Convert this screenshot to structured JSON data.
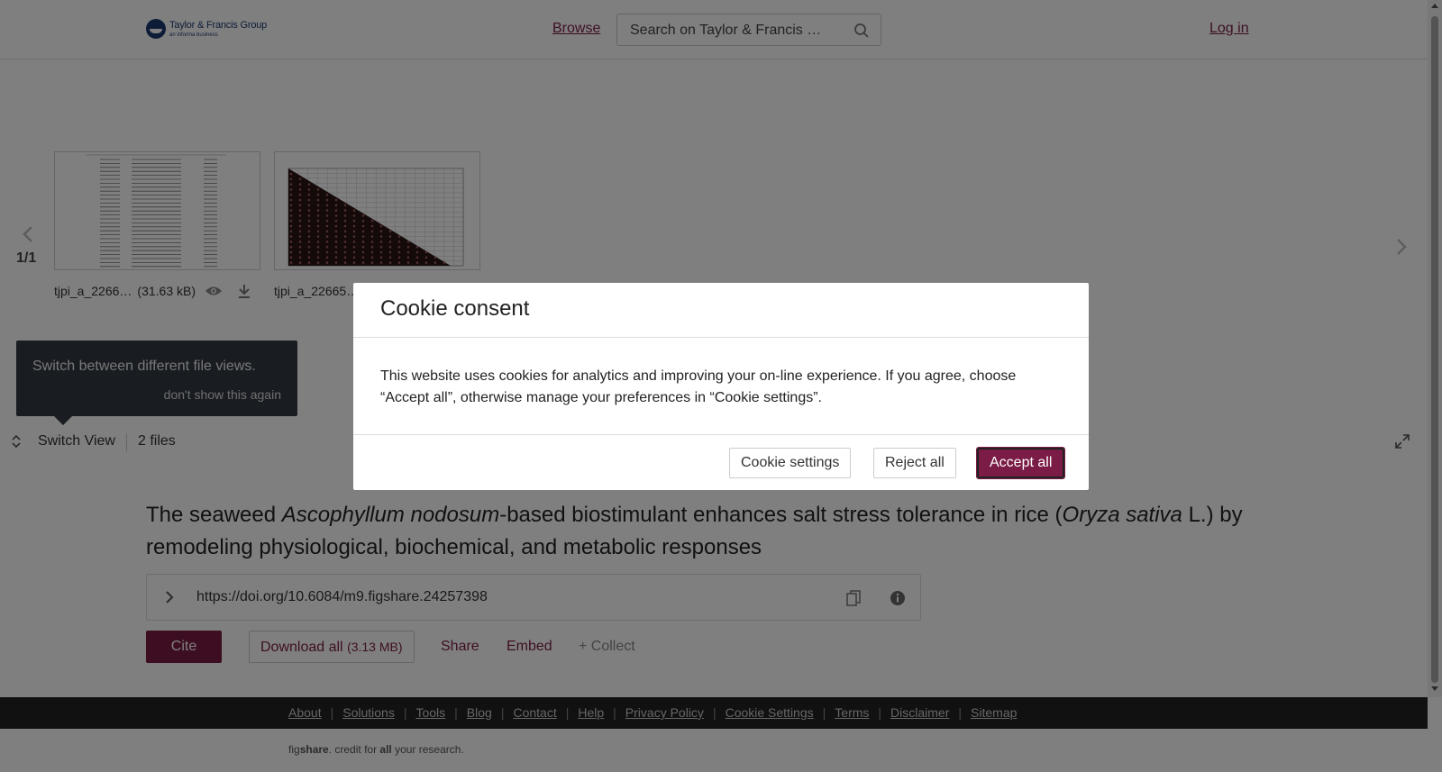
{
  "header": {
    "logo_main": "Taylor & Francis Group",
    "logo_sub": "an informa business",
    "browse": "Browse",
    "search_placeholder": "Search on Taylor & Francis …",
    "login": "Log in"
  },
  "viewer": {
    "page_count": "1/1",
    "files": [
      {
        "name": "tjpi_a_2266…",
        "size": "(31.63 kB)"
      },
      {
        "name": "tjpi_a_22665…",
        "size": ""
      }
    ],
    "tooltip_text": "Switch between different file views.",
    "tooltip_dismiss": "don't show this again",
    "switch_view": "Switch View",
    "files_count": "2 files"
  },
  "article": {
    "title_parts": [
      {
        "text": "The seaweed ",
        "italic": false
      },
      {
        "text": "Ascophyllum nodosum",
        "italic": true
      },
      {
        "text": "-based biostimulant enhances salt stress tolerance in rice (",
        "italic": false
      },
      {
        "text": "Oryza sativa",
        "italic": true
      },
      {
        "text": " L.) by remodeling physiological, biochemical, and metabolic responses",
        "italic": false
      }
    ],
    "doi": "https://doi.org/10.6084/m9.figshare.24257398",
    "cite": "Cite",
    "download_all": "Download all",
    "download_size": "(3.13 MB)",
    "share": "Share",
    "embed": "Embed",
    "collect": "+ Collect"
  },
  "footer": {
    "links": [
      "About",
      "Solutions",
      "Tools",
      "Blog",
      "Contact",
      "Help",
      "Privacy Policy",
      "Cookie Settings",
      "Terms",
      "Disclaimer",
      "Sitemap"
    ],
    "tagline_fig": "fig",
    "tagline_share": "share",
    "tagline_rest1": ". credit for ",
    "tagline_all": "all",
    "tagline_rest2": " your research."
  },
  "cookie_modal": {
    "title": "Cookie consent",
    "body": "This website uses cookies for analytics and improving your on-line experience. If you agree, choose “Accept all”, otherwise manage your preferences in “Cookie settings”.",
    "settings_button": "Cookie settings",
    "reject_button": "Reject all",
    "accept_button": "Accept all"
  },
  "colors": {
    "brand": "#7a1c45",
    "footer_bg": "#222222",
    "tooltip_bg": "#333b44"
  },
  "icons": [
    "search-icon",
    "chevron-left-icon",
    "chevron-right-icon",
    "eye-icon",
    "download-icon",
    "switch-view-icon",
    "expand-icon",
    "chevron-right-icon",
    "copy-icon",
    "info-icon"
  ]
}
